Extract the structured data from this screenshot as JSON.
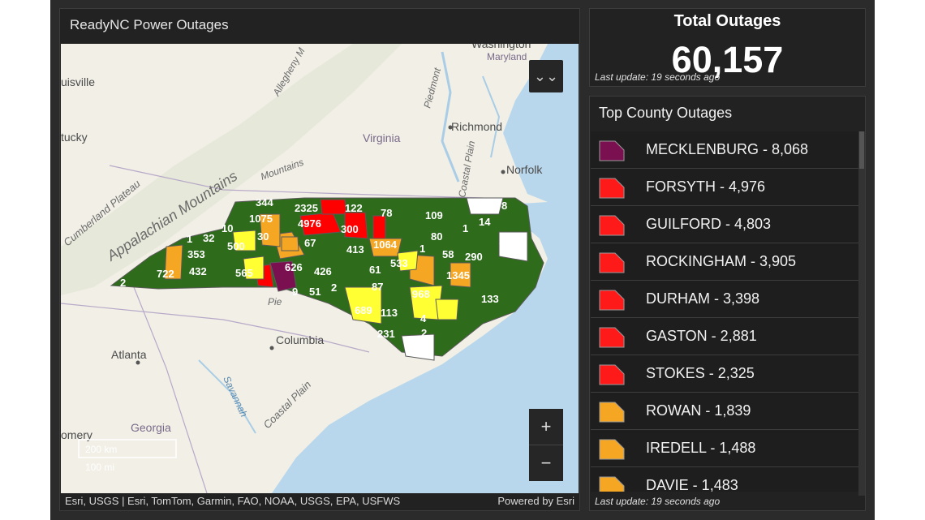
{
  "map_panel": {
    "title": "ReadyNC Power Outages",
    "attribution": "Esri, USGS | Esri, TomTom, Garmin, FAO, NOAA, USGS, EPA, USFWS",
    "powered_by": "Powered by Esri",
    "collapse_icon": "chevron-double-down-icon",
    "zoom_in": "+",
    "zoom_out": "−",
    "scale_bar": [
      "200 km",
      "100 mi"
    ]
  },
  "map_labels": {
    "places": [
      "Washington",
      "Maryland",
      "Richmond",
      "Norfolk",
      "Virginia",
      "Columbia",
      "Atlanta",
      "Georgia",
      "uisville",
      "tucky",
      "omery"
    ],
    "features": [
      "Appalachian Mountains",
      "Cumberland Plateau",
      "Allegheny M",
      "Piedmont",
      "Coastal Plain",
      "Coastal Plain",
      "Savannah",
      "Mountains",
      "Pie"
    ]
  },
  "county_counts": [
    "344",
    "2325",
    "122",
    "1075",
    "4976",
    "300",
    "78",
    "109",
    "1",
    "8",
    "10",
    "1",
    "14",
    "1",
    "32",
    "500",
    "30",
    "67",
    "413",
    "1064",
    "1",
    "80",
    "87",
    "4",
    "353",
    "565",
    "626",
    "426",
    "533",
    "58",
    "290",
    "722",
    "432",
    "61",
    "1345",
    "2",
    "9",
    "51",
    "2",
    "87",
    "968",
    "133",
    "689",
    "113",
    "4",
    "231",
    "2"
  ],
  "colors": {
    "legend_purple": "#7a1050",
    "legend_red": "#ff0000",
    "legend_orange": "#f5a623",
    "legend_yellow": "#ffff33",
    "legend_green": "#2e6b1b",
    "water": "#b9d7ec",
    "land": "#f1efe6"
  },
  "total": {
    "label": "Total Outages",
    "value": "60,157",
    "update": "Last update: 19 seconds ago"
  },
  "top_counties": {
    "title": "Top County Outages",
    "items": [
      {
        "label": "MECKLENBURG - 8,068",
        "color": "#7a1050"
      },
      {
        "label": "FORSYTH - 4,976",
        "color": "#ff1a1a"
      },
      {
        "label": "GUILFORD - 4,803",
        "color": "#ff1a1a"
      },
      {
        "label": "ROCKINGHAM - 3,905",
        "color": "#ff1a1a"
      },
      {
        "label": "DURHAM - 3,398",
        "color": "#ff1a1a"
      },
      {
        "label": "GASTON - 2,881",
        "color": "#ff1a1a"
      },
      {
        "label": "STOKES - 2,325",
        "color": "#ff1a1a"
      },
      {
        "label": "ROWAN - 1,839",
        "color": "#f5a623"
      },
      {
        "label": "IREDELL - 1,488",
        "color": "#f5a623"
      },
      {
        "label": "DAVIE - 1,483",
        "color": "#f5a623"
      }
    ],
    "update": "Last update: 19 seconds ago"
  }
}
